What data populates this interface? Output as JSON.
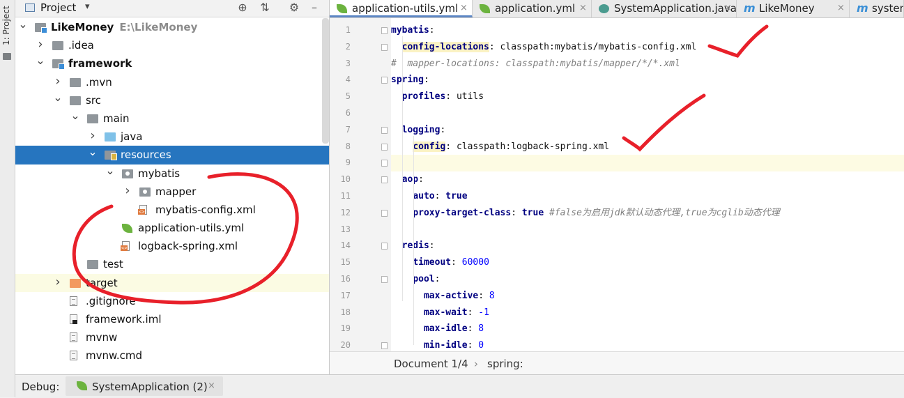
{
  "sidebar_stripe": {
    "label": "1: Project"
  },
  "project_panel": {
    "title": "Project",
    "tree": [
      {
        "label": "LikeMoney",
        "path": "E:\\LikeMoney",
        "bold": true,
        "depth": 0,
        "chevron": "down",
        "icon": "module-folder"
      },
      {
        "label": ".idea",
        "depth": 1,
        "chevron": "right",
        "icon": "folder"
      },
      {
        "label": "framework",
        "bold": true,
        "depth": 1,
        "chevron": "down",
        "icon": "module-folder"
      },
      {
        "label": ".mvn",
        "depth": 2,
        "chevron": "right",
        "icon": "folder"
      },
      {
        "label": "src",
        "depth": 2,
        "chevron": "down",
        "icon": "folder"
      },
      {
        "label": "main",
        "depth": 3,
        "chevron": "down",
        "icon": "folder"
      },
      {
        "label": "java",
        "depth": 4,
        "chevron": "right",
        "icon": "source-folder"
      },
      {
        "label": "resources",
        "depth": 4,
        "chevron": "down",
        "icon": "resources-folder",
        "selected": true
      },
      {
        "label": "mybatis",
        "depth": 5,
        "chevron": "down",
        "icon": "package-folder"
      },
      {
        "label": "mapper",
        "depth": 6,
        "chevron": "right",
        "icon": "package-folder"
      },
      {
        "label": "mybatis-config.xml",
        "depth": 6,
        "chevron": "",
        "icon": "xml-file"
      },
      {
        "label": "application-utils.yml",
        "depth": 5,
        "chevron": "",
        "icon": "spring-yml-file"
      },
      {
        "label": "logback-spring.xml",
        "depth": 5,
        "chevron": "",
        "icon": "xml-file"
      },
      {
        "label": "test",
        "depth": 3,
        "chevron": "right",
        "icon": "folder"
      },
      {
        "label": "target",
        "depth": 2,
        "chevron": "right",
        "icon": "excluded-folder",
        "highlighted": true
      },
      {
        "label": ".gitignore",
        "depth": 2,
        "chevron": "",
        "icon": "text-file"
      },
      {
        "label": "framework.iml",
        "depth": 2,
        "chevron": "",
        "icon": "iml-file"
      },
      {
        "label": "mvnw",
        "depth": 2,
        "chevron": "",
        "icon": "text-file"
      },
      {
        "label": "mvnw.cmd",
        "depth": 2,
        "chevron": "",
        "icon": "text-file"
      }
    ]
  },
  "editor": {
    "tabs": [
      {
        "label": "application-utils.yml",
        "icon": "spring-leaf-icon",
        "active": true
      },
      {
        "label": "application.yml",
        "icon": "spring-leaf-icon",
        "active": false
      },
      {
        "label": "SystemApplication.java",
        "icon": "spring-class-icon",
        "active": false
      },
      {
        "label": "LikeMoney",
        "icon": "maven-icon",
        "active": false
      },
      {
        "label": "system",
        "icon": "maven-icon",
        "active": false
      }
    ],
    "lines": [
      {
        "n": "1",
        "indent": 0,
        "key": "mybatis",
        "sep": ":",
        "fold": true
      },
      {
        "n": "2",
        "indent": 1,
        "key": "config-locations",
        "sep": ": ",
        "value": "classpath:mybatis/mybatis-config.xml",
        "fold": true,
        "keyhl": true
      },
      {
        "n": "3",
        "indent": 0,
        "comment": "#  mapper-locations: classpath:mybatis/mapper/*/*.xml"
      },
      {
        "n": "4",
        "indent": 0,
        "key": "spring",
        "sep": ":",
        "fold": true
      },
      {
        "n": "5",
        "indent": 1,
        "key": "profiles",
        "sep": ": ",
        "value": "utils"
      },
      {
        "n": "6",
        "indent": 0
      },
      {
        "n": "7",
        "indent": 1,
        "key": "logging",
        "sep": ":",
        "fold": true
      },
      {
        "n": "8",
        "indent": 2,
        "key": "config",
        "sep": ": ",
        "value": "classpath:logback-spring.xml",
        "fold": true,
        "keyhl": true
      },
      {
        "n": "9",
        "indent": 0,
        "current": true,
        "fold": true
      },
      {
        "n": "10",
        "indent": 1,
        "key": "aop",
        "sep": ":",
        "fold": true
      },
      {
        "n": "11",
        "indent": 2,
        "key": "auto",
        "sep": ": ",
        "bool": "true"
      },
      {
        "n": "12",
        "indent": 2,
        "key": "proxy-target-class",
        "sep": ": ",
        "bool": "true",
        "comment_tail": "#false为启用jdk默认动态代理,true为cglib动态代理",
        "fold": true
      },
      {
        "n": "13",
        "indent": 0
      },
      {
        "n": "14",
        "indent": 1,
        "key": "redis",
        "sep": ":",
        "fold": true
      },
      {
        "n": "15",
        "indent": 2,
        "key": "timeout",
        "sep": ": ",
        "num": "60000"
      },
      {
        "n": "16",
        "indent": 2,
        "key": "pool",
        "sep": ":",
        "fold": true
      },
      {
        "n": "17",
        "indent": 3,
        "key": "max-active",
        "sep": ": ",
        "num": "8"
      },
      {
        "n": "18",
        "indent": 3,
        "key": "max-wait",
        "sep": ": ",
        "num": "-1"
      },
      {
        "n": "19",
        "indent": 3,
        "key": "max-idle",
        "sep": ": ",
        "num": "8"
      },
      {
        "n": "20",
        "indent": 3,
        "key": "min-idle",
        "sep": ": ",
        "num": "0",
        "fold": true
      }
    ],
    "breadcrumb": {
      "doc": "Document 1/4",
      "separator": "›",
      "path": "spring:"
    }
  },
  "debug_bar": {
    "label": "Debug:",
    "tab": "SystemApplication (2)",
    "close": "×"
  },
  "colors": {
    "selection": "#2675bf",
    "yaml_key": "#000080",
    "annotation_red": "#e8202a"
  }
}
